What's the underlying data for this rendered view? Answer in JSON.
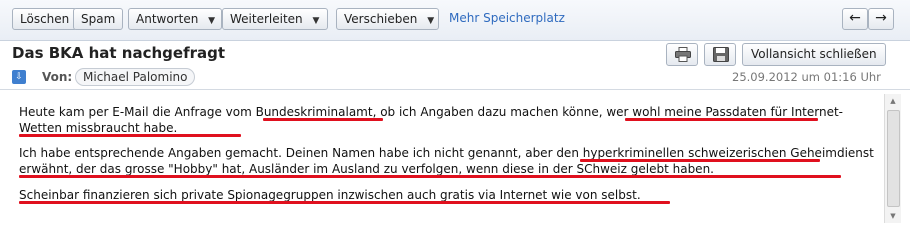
{
  "toolbar": {
    "delete_label": "Löschen",
    "spam_label": "Spam",
    "reply_label": "Antworten",
    "forward_label": "Weiterleiten",
    "move_label": "Verschieben",
    "storage_link": "Mehr Speicherplatz",
    "prev_icon": "arrow-left-icon",
    "next_icon": "arrow-right-icon"
  },
  "message": {
    "subject": "Das BKA hat nachgefragt",
    "from_label": "Von:",
    "from_name": "Michael Palomino",
    "date": "25.09.2012 um 01:16 Uhr",
    "fullview_label": "Vollansicht schließen",
    "print_icon": "printer-icon",
    "save_icon": "floppy-disk-icon"
  },
  "body": {
    "paragraph1": "Heute kam per E-Mail die Anfrage vom Bundeskriminalamt, ob ich Angaben dazu machen könne, wer wohl meine Passdaten für Internet-Wetten missbraucht habe.",
    "paragraph2": "Ich habe entsprechende Angaben gemacht. Deinen Namen habe ich nicht genannt, aber den hyperkriminellen schweizerischen Geheimdienst erwähnt, der das grosse \"Hobby\" hat, Ausländer im Ausland zu verfolgen, wenn diese in der SChweiz gelebt haben.",
    "paragraph3": "Scheinbar finanzieren sich private Spionagegruppen inzwischen auch gratis via Internet wie von selbst."
  },
  "colors": {
    "annotation_underline": "#e0101e",
    "link": "#2f6bbf",
    "expand_badge": "#3f7fcf"
  }
}
